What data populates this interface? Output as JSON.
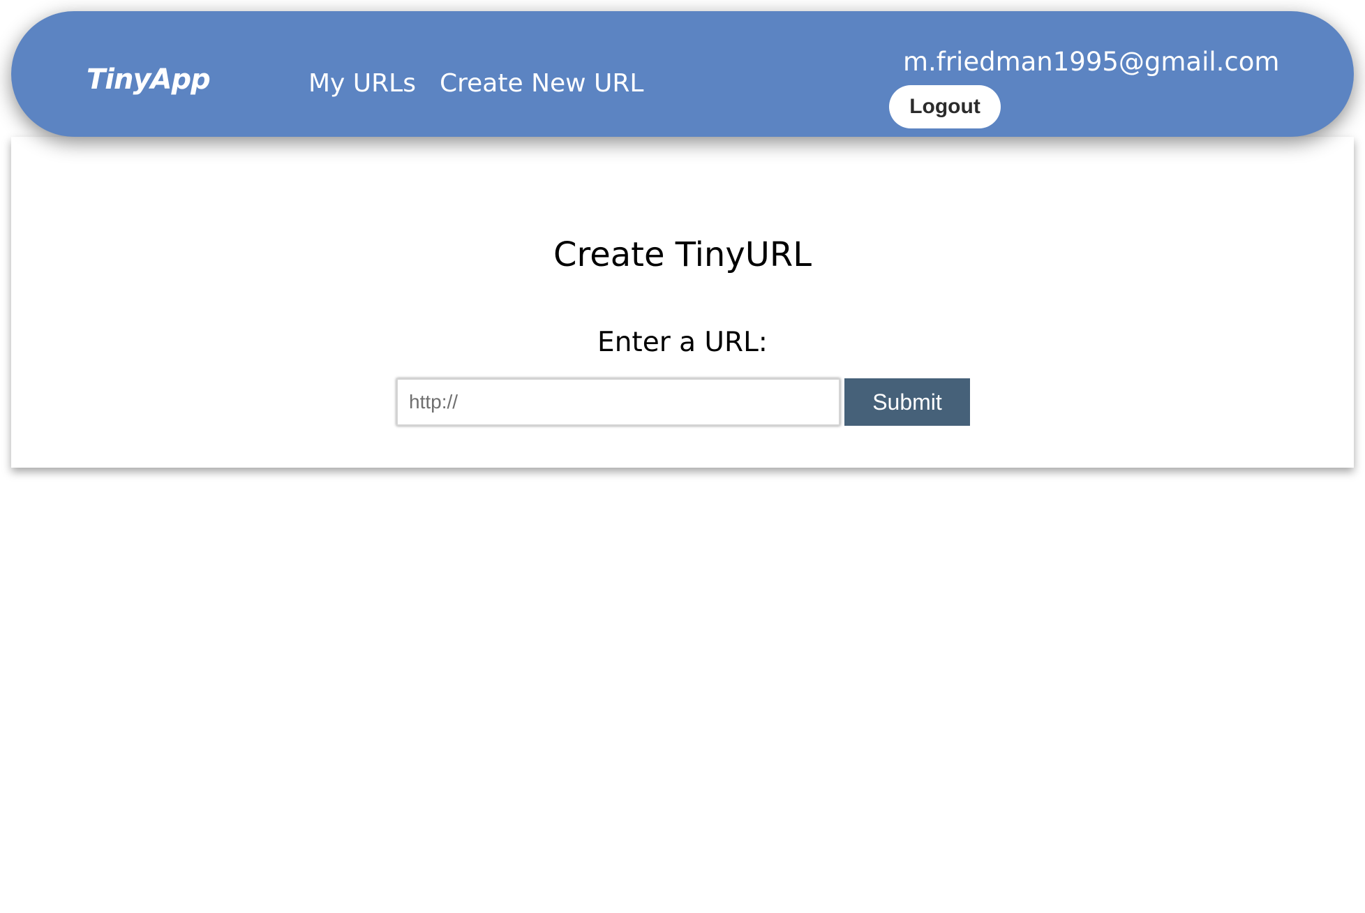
{
  "navbar": {
    "brand": "TinyApp",
    "links": [
      {
        "label": "My URLs"
      },
      {
        "label": "Create New URL"
      }
    ],
    "user_email": "m.friedman1995@gmail.com",
    "logout_label": "Logout",
    "background_color": "#5c84c2"
  },
  "main": {
    "title": "Create TinyURL",
    "form": {
      "label": "Enter a URL:",
      "input_placeholder": "http://",
      "input_value": "",
      "submit_label": "Submit",
      "submit_color": "#466179"
    }
  }
}
